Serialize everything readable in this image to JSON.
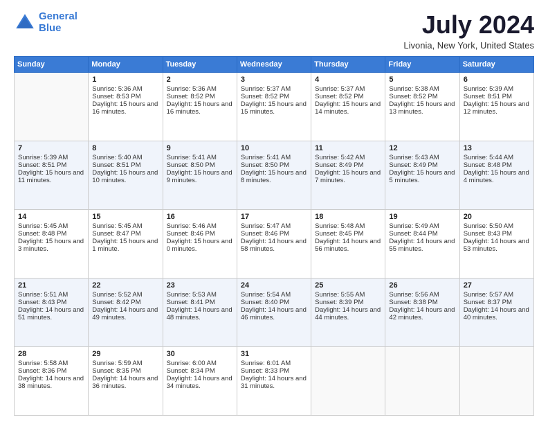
{
  "logo": {
    "line1": "General",
    "line2": "Blue"
  },
  "title": "July 2024",
  "location": "Livonia, New York, United States",
  "days": [
    "Sunday",
    "Monday",
    "Tuesday",
    "Wednesday",
    "Thursday",
    "Friday",
    "Saturday"
  ],
  "weeks": [
    [
      {
        "date": "",
        "sunrise": "",
        "sunset": "",
        "daylight": ""
      },
      {
        "date": "1",
        "sunrise": "Sunrise: 5:36 AM",
        "sunset": "Sunset: 8:53 PM",
        "daylight": "Daylight: 15 hours and 16 minutes."
      },
      {
        "date": "2",
        "sunrise": "Sunrise: 5:36 AM",
        "sunset": "Sunset: 8:52 PM",
        "daylight": "Daylight: 15 hours and 16 minutes."
      },
      {
        "date": "3",
        "sunrise": "Sunrise: 5:37 AM",
        "sunset": "Sunset: 8:52 PM",
        "daylight": "Daylight: 15 hours and 15 minutes."
      },
      {
        "date": "4",
        "sunrise": "Sunrise: 5:37 AM",
        "sunset": "Sunset: 8:52 PM",
        "daylight": "Daylight: 15 hours and 14 minutes."
      },
      {
        "date": "5",
        "sunrise": "Sunrise: 5:38 AM",
        "sunset": "Sunset: 8:52 PM",
        "daylight": "Daylight: 15 hours and 13 minutes."
      },
      {
        "date": "6",
        "sunrise": "Sunrise: 5:39 AM",
        "sunset": "Sunset: 8:51 PM",
        "daylight": "Daylight: 15 hours and 12 minutes."
      }
    ],
    [
      {
        "date": "7",
        "sunrise": "Sunrise: 5:39 AM",
        "sunset": "Sunset: 8:51 PM",
        "daylight": "Daylight: 15 hours and 11 minutes."
      },
      {
        "date": "8",
        "sunrise": "Sunrise: 5:40 AM",
        "sunset": "Sunset: 8:51 PM",
        "daylight": "Daylight: 15 hours and 10 minutes."
      },
      {
        "date": "9",
        "sunrise": "Sunrise: 5:41 AM",
        "sunset": "Sunset: 8:50 PM",
        "daylight": "Daylight: 15 hours and 9 minutes."
      },
      {
        "date": "10",
        "sunrise": "Sunrise: 5:41 AM",
        "sunset": "Sunset: 8:50 PM",
        "daylight": "Daylight: 15 hours and 8 minutes."
      },
      {
        "date": "11",
        "sunrise": "Sunrise: 5:42 AM",
        "sunset": "Sunset: 8:49 PM",
        "daylight": "Daylight: 15 hours and 7 minutes."
      },
      {
        "date": "12",
        "sunrise": "Sunrise: 5:43 AM",
        "sunset": "Sunset: 8:49 PM",
        "daylight": "Daylight: 15 hours and 5 minutes."
      },
      {
        "date": "13",
        "sunrise": "Sunrise: 5:44 AM",
        "sunset": "Sunset: 8:48 PM",
        "daylight": "Daylight: 15 hours and 4 minutes."
      }
    ],
    [
      {
        "date": "14",
        "sunrise": "Sunrise: 5:45 AM",
        "sunset": "Sunset: 8:48 PM",
        "daylight": "Daylight: 15 hours and 3 minutes."
      },
      {
        "date": "15",
        "sunrise": "Sunrise: 5:45 AM",
        "sunset": "Sunset: 8:47 PM",
        "daylight": "Daylight: 15 hours and 1 minute."
      },
      {
        "date": "16",
        "sunrise": "Sunrise: 5:46 AM",
        "sunset": "Sunset: 8:46 PM",
        "daylight": "Daylight: 15 hours and 0 minutes."
      },
      {
        "date": "17",
        "sunrise": "Sunrise: 5:47 AM",
        "sunset": "Sunset: 8:46 PM",
        "daylight": "Daylight: 14 hours and 58 minutes."
      },
      {
        "date": "18",
        "sunrise": "Sunrise: 5:48 AM",
        "sunset": "Sunset: 8:45 PM",
        "daylight": "Daylight: 14 hours and 56 minutes."
      },
      {
        "date": "19",
        "sunrise": "Sunrise: 5:49 AM",
        "sunset": "Sunset: 8:44 PM",
        "daylight": "Daylight: 14 hours and 55 minutes."
      },
      {
        "date": "20",
        "sunrise": "Sunrise: 5:50 AM",
        "sunset": "Sunset: 8:43 PM",
        "daylight": "Daylight: 14 hours and 53 minutes."
      }
    ],
    [
      {
        "date": "21",
        "sunrise": "Sunrise: 5:51 AM",
        "sunset": "Sunset: 8:43 PM",
        "daylight": "Daylight: 14 hours and 51 minutes."
      },
      {
        "date": "22",
        "sunrise": "Sunrise: 5:52 AM",
        "sunset": "Sunset: 8:42 PM",
        "daylight": "Daylight: 14 hours and 49 minutes."
      },
      {
        "date": "23",
        "sunrise": "Sunrise: 5:53 AM",
        "sunset": "Sunset: 8:41 PM",
        "daylight": "Daylight: 14 hours and 48 minutes."
      },
      {
        "date": "24",
        "sunrise": "Sunrise: 5:54 AM",
        "sunset": "Sunset: 8:40 PM",
        "daylight": "Daylight: 14 hours and 46 minutes."
      },
      {
        "date": "25",
        "sunrise": "Sunrise: 5:55 AM",
        "sunset": "Sunset: 8:39 PM",
        "daylight": "Daylight: 14 hours and 44 minutes."
      },
      {
        "date": "26",
        "sunrise": "Sunrise: 5:56 AM",
        "sunset": "Sunset: 8:38 PM",
        "daylight": "Daylight: 14 hours and 42 minutes."
      },
      {
        "date": "27",
        "sunrise": "Sunrise: 5:57 AM",
        "sunset": "Sunset: 8:37 PM",
        "daylight": "Daylight: 14 hours and 40 minutes."
      }
    ],
    [
      {
        "date": "28",
        "sunrise": "Sunrise: 5:58 AM",
        "sunset": "Sunset: 8:36 PM",
        "daylight": "Daylight: 14 hours and 38 minutes."
      },
      {
        "date": "29",
        "sunrise": "Sunrise: 5:59 AM",
        "sunset": "Sunset: 8:35 PM",
        "daylight": "Daylight: 14 hours and 36 minutes."
      },
      {
        "date": "30",
        "sunrise": "Sunrise: 6:00 AM",
        "sunset": "Sunset: 8:34 PM",
        "daylight": "Daylight: 14 hours and 34 minutes."
      },
      {
        "date": "31",
        "sunrise": "Sunrise: 6:01 AM",
        "sunset": "Sunset: 8:33 PM",
        "daylight": "Daylight: 14 hours and 31 minutes."
      },
      {
        "date": "",
        "sunrise": "",
        "sunset": "",
        "daylight": ""
      },
      {
        "date": "",
        "sunrise": "",
        "sunset": "",
        "daylight": ""
      },
      {
        "date": "",
        "sunrise": "",
        "sunset": "",
        "daylight": ""
      }
    ]
  ]
}
